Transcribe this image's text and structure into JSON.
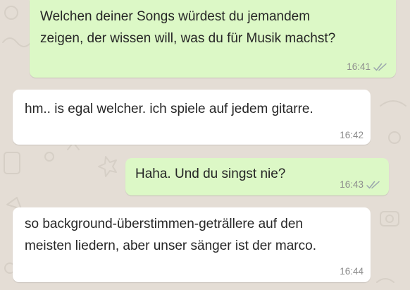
{
  "chat": {
    "messages": [
      {
        "direction": "outgoing",
        "text": "Welchen deiner Songs würdest du jemandem\nzeigen, der wissen will, was du für Musik machst?",
        "time": "16:41",
        "status_icon": "double-check-icon"
      },
      {
        "direction": "incoming",
        "text": "hm.. is egal welcher. ich spiele auf jedem gitarre.",
        "time": "16:42"
      },
      {
        "direction": "outgoing",
        "text": "Haha. Und du singst nie?",
        "time": "16:43",
        "status_icon": "double-check-icon"
      },
      {
        "direction": "incoming",
        "text": "so background-überstimmen-geträllere auf den\nmeisten liedern, aber unser sänger ist der marco.",
        "time": "16:44"
      }
    ]
  },
  "colors": {
    "wallpaper": "#e4ddd5",
    "outgoing_bubble": "#dcf8c6",
    "incoming_bubble": "#ffffff",
    "timestamp": "#8d8d8d"
  }
}
